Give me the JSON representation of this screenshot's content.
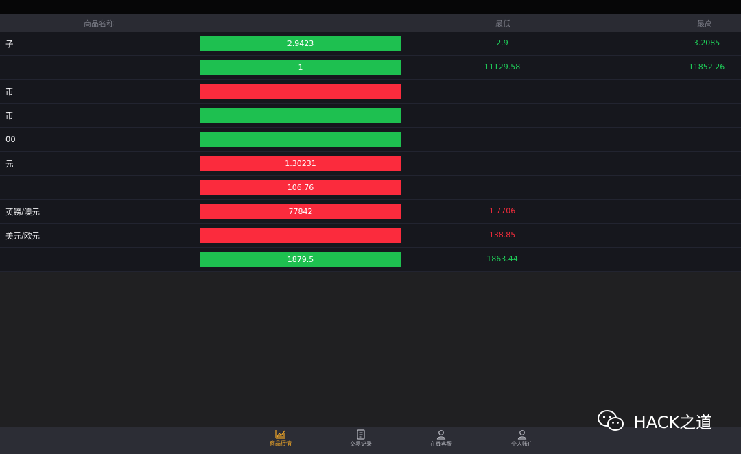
{
  "table": {
    "headers": {
      "name": "商品名称",
      "low": "最低",
      "high": "最高"
    },
    "rows": [
      {
        "name": "子",
        "price": "2.9423",
        "low": "2.9",
        "high": "3.2085",
        "trend": "up"
      },
      {
        "name": "",
        "price": "1",
        "low": "11129.58",
        "high": "11852.26",
        "trend": "up"
      },
      {
        "name": "币",
        "price": "",
        "low": "",
        "high": "",
        "trend": "down"
      },
      {
        "name": "币",
        "price": "",
        "low": "",
        "high": "",
        "trend": "up"
      },
      {
        "name": "00",
        "price": "",
        "low": "",
        "high": "",
        "trend": "up"
      },
      {
        "name": "元",
        "price": "1.30231",
        "low": "",
        "high": "",
        "trend": "down"
      },
      {
        "name": "",
        "price": "106.76",
        "low": "",
        "high": "",
        "trend": "down"
      },
      {
        "name": "英镑/澳元",
        "price": "77842",
        "low": "1.7706",
        "high": "",
        "trend": "down"
      },
      {
        "name": "美元/欧元",
        "price": "",
        "low": "138.85",
        "high": "",
        "trend": "down"
      },
      {
        "name": "",
        "price": "1879.5",
        "low": "1863.44",
        "high": "",
        "trend": "up"
      }
    ]
  },
  "bottom_nav": {
    "items": [
      {
        "label": "商品行情",
        "icon": "chart-icon",
        "active": true
      },
      {
        "label": "交易记录",
        "icon": "document-icon",
        "active": false
      },
      {
        "label": "在线客服",
        "icon": "user-icon",
        "active": false
      },
      {
        "label": "个人账户",
        "icon": "user-icon",
        "active": false
      }
    ]
  },
  "watermark": {
    "text": "HACK之道",
    "icon": "wechat-icon"
  },
  "colors": {
    "up": "#1ec050",
    "down": "#fb2b3d",
    "active_nav": "#f0a728"
  }
}
